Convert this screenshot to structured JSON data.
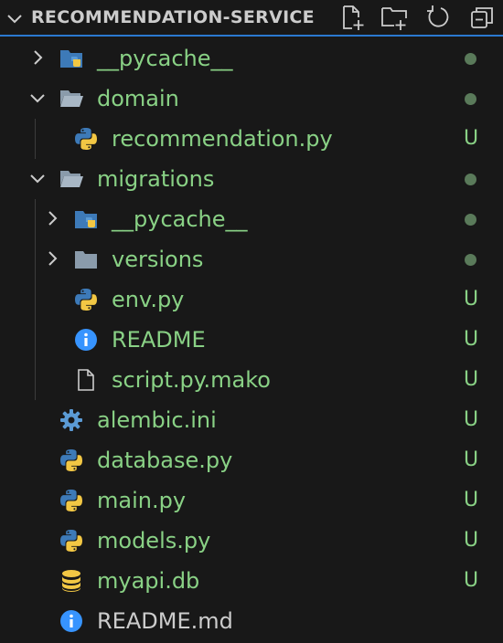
{
  "explorer": {
    "title": "RECOMMENDATION-SERVICE",
    "actions": [
      {
        "icon": "new-file-icon"
      },
      {
        "icon": "new-folder-icon"
      },
      {
        "icon": "refresh-icon"
      },
      {
        "icon": "collapse-all-icon"
      }
    ]
  },
  "tree": [
    {
      "label": "__pycache__",
      "kind": "folder-python",
      "expanded": false,
      "status": "dot",
      "status_text": ""
    },
    {
      "label": "domain",
      "kind": "folder",
      "expanded": true,
      "status": "dot",
      "status_text": ""
    },
    {
      "label": "recommendation.py",
      "kind": "python",
      "status": "U",
      "status_text": "U"
    },
    {
      "label": "migrations",
      "kind": "folder",
      "expanded": true,
      "status": "dot",
      "status_text": ""
    },
    {
      "label": "__pycache__",
      "kind": "folder-python",
      "expanded": false,
      "status": "dot",
      "status_text": ""
    },
    {
      "label": "versions",
      "kind": "folder",
      "expanded": false,
      "status": "dot",
      "status_text": ""
    },
    {
      "label": "env.py",
      "kind": "python",
      "status": "U",
      "status_text": "U"
    },
    {
      "label": "README",
      "kind": "info",
      "status": "U",
      "status_text": "U"
    },
    {
      "label": "script.py.mako",
      "kind": "file",
      "status": "U",
      "status_text": "U"
    },
    {
      "label": "alembic.ini",
      "kind": "gear",
      "status": "U",
      "status_text": "U"
    },
    {
      "label": "database.py",
      "kind": "python",
      "status": "U",
      "status_text": "U"
    },
    {
      "label": "main.py",
      "kind": "python",
      "status": "U",
      "status_text": "U"
    },
    {
      "label": "models.py",
      "kind": "python",
      "status": "U",
      "status_text": "U"
    },
    {
      "label": "myapi.db",
      "kind": "database",
      "status": "U",
      "status_text": "U"
    },
    {
      "label": "README.md",
      "kind": "info",
      "status": "none",
      "status_text": ""
    }
  ],
  "colors": {
    "untracked": "#89d185",
    "python_blue": "#3d7ab8",
    "python_yellow": "#f2c744",
    "info_blue": "#3794ff",
    "folder_gray": "#8a9bab",
    "accent": "#2b79d0"
  }
}
